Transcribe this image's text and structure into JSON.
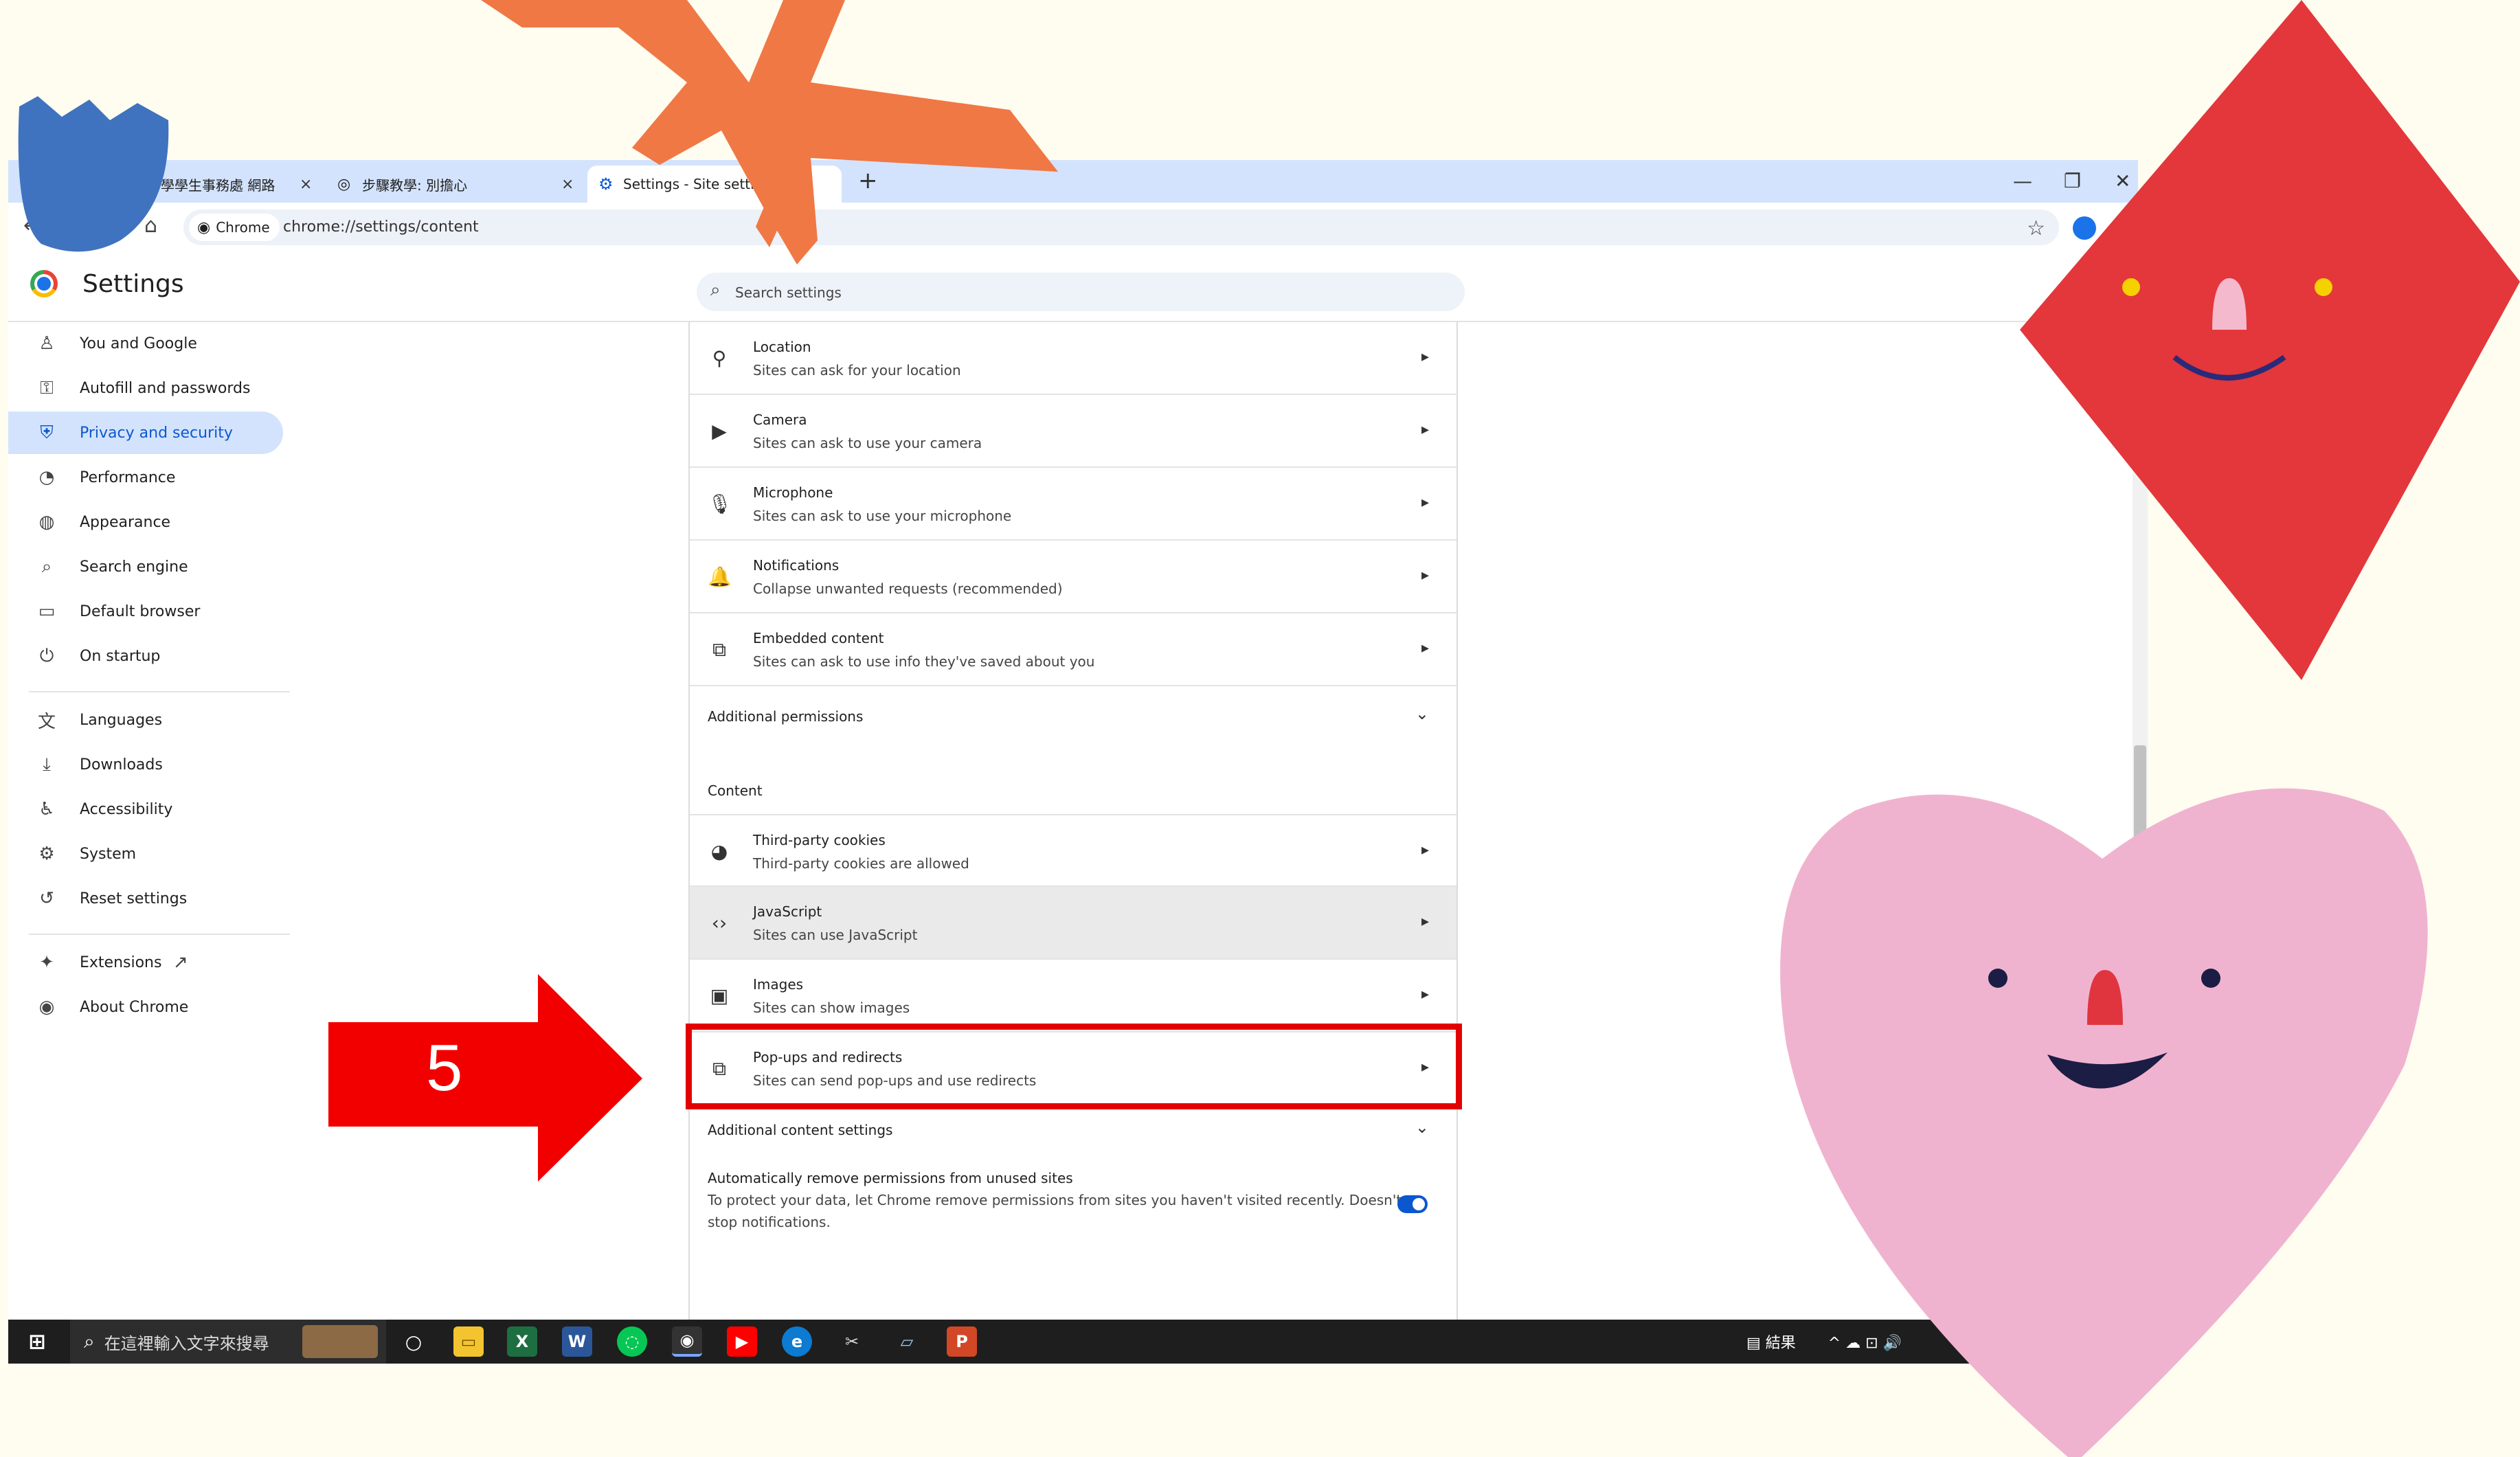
{
  "tabs": [
    {
      "label": "學學生事務處 網路",
      "close": "×"
    },
    {
      "label": "步驟教學: 別擔心",
      "close": "×"
    },
    {
      "label": "Settings - Site settings",
      "close": ""
    }
  ],
  "new_tab": "+",
  "window_controls": {
    "minimize": "—",
    "restore": "❐",
    "close": "✕"
  },
  "toolbar": {
    "back": "←",
    "reload": "↻",
    "home": "⌂",
    "chip_label": "Chrome",
    "url": "chrome://settings/content",
    "bookmark": "☆"
  },
  "header": {
    "title": "Settings",
    "search_placeholder": "Search settings",
    "search_icon": "⌕"
  },
  "sidebar": {
    "items": [
      {
        "label": "You and Google",
        "icon": "♙"
      },
      {
        "label": "Autofill and passwords",
        "icon": "⚿"
      },
      {
        "label": "Privacy and security",
        "icon": "⛨",
        "active": true
      },
      {
        "label": "Performance",
        "icon": "◔"
      },
      {
        "label": "Appearance",
        "icon": "◍"
      },
      {
        "label": "Search engine",
        "icon": "⌕"
      },
      {
        "label": "Default browser",
        "icon": "▭"
      },
      {
        "label": "On startup",
        "icon": "⏻"
      },
      {
        "label": "Languages",
        "icon": "文"
      },
      {
        "label": "Downloads",
        "icon": "⤓"
      },
      {
        "label": "Accessibility",
        "icon": "♿"
      },
      {
        "label": "System",
        "icon": "⚙"
      },
      {
        "label": "Reset settings",
        "icon": "↺"
      },
      {
        "label": "Extensions",
        "icon": "✦",
        "ext_icon": "↗"
      },
      {
        "label": "About Chrome",
        "icon": "◉"
      }
    ]
  },
  "permissions": [
    {
      "title": "Location",
      "subtitle": "Sites can ask for your location",
      "icon": "⚲"
    },
    {
      "title": "Camera",
      "subtitle": "Sites can ask to use your camera",
      "icon": "▶"
    },
    {
      "title": "Microphone",
      "subtitle": "Sites can ask to use your microphone",
      "icon": "🎙"
    },
    {
      "title": "Notifications",
      "subtitle": "Collapse unwanted requests (recommended)",
      "icon": "🔔"
    },
    {
      "title": "Embedded content",
      "subtitle": "Sites can ask to use info they've saved about you",
      "icon": "⧉"
    }
  ],
  "additional_permissions": "Additional permissions",
  "content_heading": "Content",
  "content_rows": [
    {
      "title": "Third-party cookies",
      "subtitle": "Third-party cookies are allowed",
      "icon": "◕"
    },
    {
      "title": "JavaScript",
      "subtitle": "Sites can use JavaScript",
      "icon": "‹›"
    },
    {
      "title": "Images",
      "subtitle": "Sites can show images",
      "icon": "▣"
    },
    {
      "title": "Pop-ups and redirects",
      "subtitle": "Sites can send pop-ups and use redirects",
      "icon": "⧉"
    }
  ],
  "additional_content_settings": "Additional content settings",
  "auto_remove": {
    "title": "Automatically remove permissions from unused sites",
    "line1": "To protect your data, let Chrome remove permissions from sites you haven't visited recently. Doesn't",
    "line2": "stop notifications.",
    "enabled": true
  },
  "chevron_right": "▸",
  "chevron_down": "⌄",
  "taskbar": {
    "search_placeholder": "在這裡輸入文字來搜尋",
    "start_icon": "windows-logo",
    "tray_text": "結果",
    "tray_icons": "^ ☁ ⊡ 🔊"
  },
  "annotation": {
    "step_number": "5"
  },
  "colors": {
    "accent": "#0b57d0",
    "tab_strip": "#d3e3fd",
    "highlight_box": "#e30000",
    "arrow": "#f20000"
  }
}
